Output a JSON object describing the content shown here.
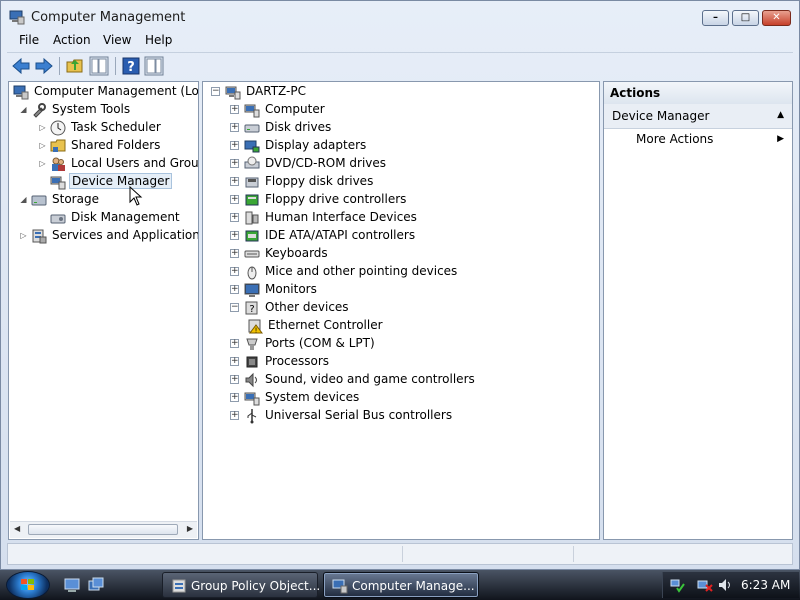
{
  "window": {
    "title": "Computer Management"
  },
  "menu": [
    "File",
    "Action",
    "View",
    "Help"
  ],
  "left_tree": [
    {
      "label": "Computer Management (Local",
      "icon": "computer-management-icon"
    },
    {
      "label": "System Tools",
      "icon": "system-tools-icon"
    },
    {
      "label": "Task Scheduler",
      "icon": "clock-icon"
    },
    {
      "label": "Shared Folders",
      "icon": "shared-folders-icon"
    },
    {
      "label": "Local Users and Groups",
      "icon": "users-icon"
    },
    {
      "label": "Device Manager",
      "icon": "device-manager-icon",
      "selected": true
    },
    {
      "label": "Storage",
      "icon": "storage-icon"
    },
    {
      "label": "Disk Management",
      "icon": "disk-management-icon"
    },
    {
      "label": "Services and Applications",
      "icon": "services-icon"
    }
  ],
  "device_tree": {
    "root": "DARTZ-PC",
    "items": [
      {
        "label": "Computer",
        "icon": "computer-icon"
      },
      {
        "label": "Disk drives",
        "icon": "disk-drive-icon"
      },
      {
        "label": "Display adapters",
        "icon": "display-adapter-icon"
      },
      {
        "label": "DVD/CD-ROM drives",
        "icon": "dvd-icon"
      },
      {
        "label": "Floppy disk drives",
        "icon": "floppy-icon"
      },
      {
        "label": "Floppy drive controllers",
        "icon": "floppy-controller-icon"
      },
      {
        "label": "Human Interface Devices",
        "icon": "hid-icon"
      },
      {
        "label": "IDE ATA/ATAPI controllers",
        "icon": "ide-controller-icon"
      },
      {
        "label": "Keyboards",
        "icon": "keyboard-icon"
      },
      {
        "label": "Mice and other pointing devices",
        "icon": "mouse-icon"
      },
      {
        "label": "Monitors",
        "icon": "monitor-icon"
      },
      {
        "label": "Other devices",
        "icon": "unknown-device-icon",
        "expanded": true
      },
      {
        "label": "Ethernet Controller",
        "icon": "warning-device-icon",
        "child": true
      },
      {
        "label": "Ports (COM & LPT)",
        "icon": "port-icon"
      },
      {
        "label": "Processors",
        "icon": "processor-icon"
      },
      {
        "label": "Sound, video and game controllers",
        "icon": "speaker-icon"
      },
      {
        "label": "System devices",
        "icon": "system-device-icon"
      },
      {
        "label": "Universal Serial Bus controllers",
        "icon": "usb-icon"
      }
    ]
  },
  "actions": {
    "header": "Actions",
    "section": "Device Manager",
    "more": "More Actions"
  },
  "taskbar": {
    "buttons": [
      {
        "label": "Group Policy Object...",
        "active": false
      },
      {
        "label": "Computer Manage...",
        "active": true
      }
    ],
    "clock": "6:23 AM"
  },
  "colors": {
    "accent": "#2d7fd3",
    "selection": "#e5eef7",
    "warning": "#f2c200"
  }
}
